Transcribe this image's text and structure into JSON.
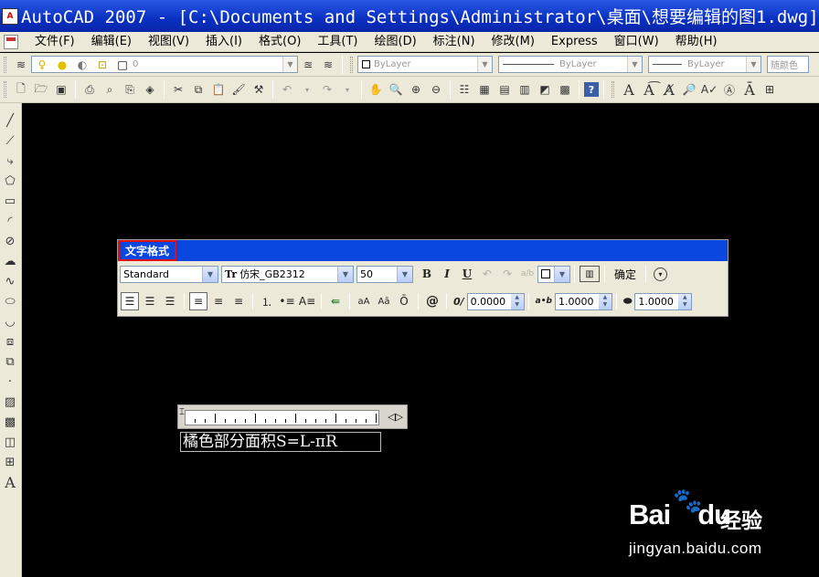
{
  "window": {
    "title": "AutoCAD 2007 - [C:\\Documents and Settings\\Administrator\\桌面\\想要编辑的图1.dwg]",
    "app_icon_text": "A"
  },
  "menu": {
    "items": [
      "文件(F)",
      "编辑(E)",
      "视图(V)",
      "插入(I)",
      "格式(O)",
      "工具(T)",
      "绘图(D)",
      "标注(N)",
      "修改(M)",
      "Express",
      "窗口(W)",
      "帮助(H)"
    ]
  },
  "properties_bar": {
    "layer_value": "0",
    "color_value": "ByLayer",
    "linetype_value": "ByLayer",
    "lineweight_value": "ByLayer",
    "plotstyle_value": "随颜色"
  },
  "text_formatting": {
    "title": "文字格式",
    "style": "Standard",
    "font_prefix": "Tr",
    "font": "仿宋_GB2312",
    "height": "50",
    "bold": "B",
    "italic": "I",
    "underline": "U",
    "ok_label": "确定",
    "oblique_value": "0.0000",
    "tracking_value": "1.0000",
    "width_value": "1.0000",
    "at_symbol": "@",
    "oblique_symbol": "0/",
    "tracking_symbol": "a•b"
  },
  "mtext": {
    "content": "橘色部分面积S=L-πR"
  },
  "watermark": {
    "brand": "Bai",
    "brand_suffix": "du",
    "service": "经验",
    "url": "jingyan.baidu.com"
  }
}
